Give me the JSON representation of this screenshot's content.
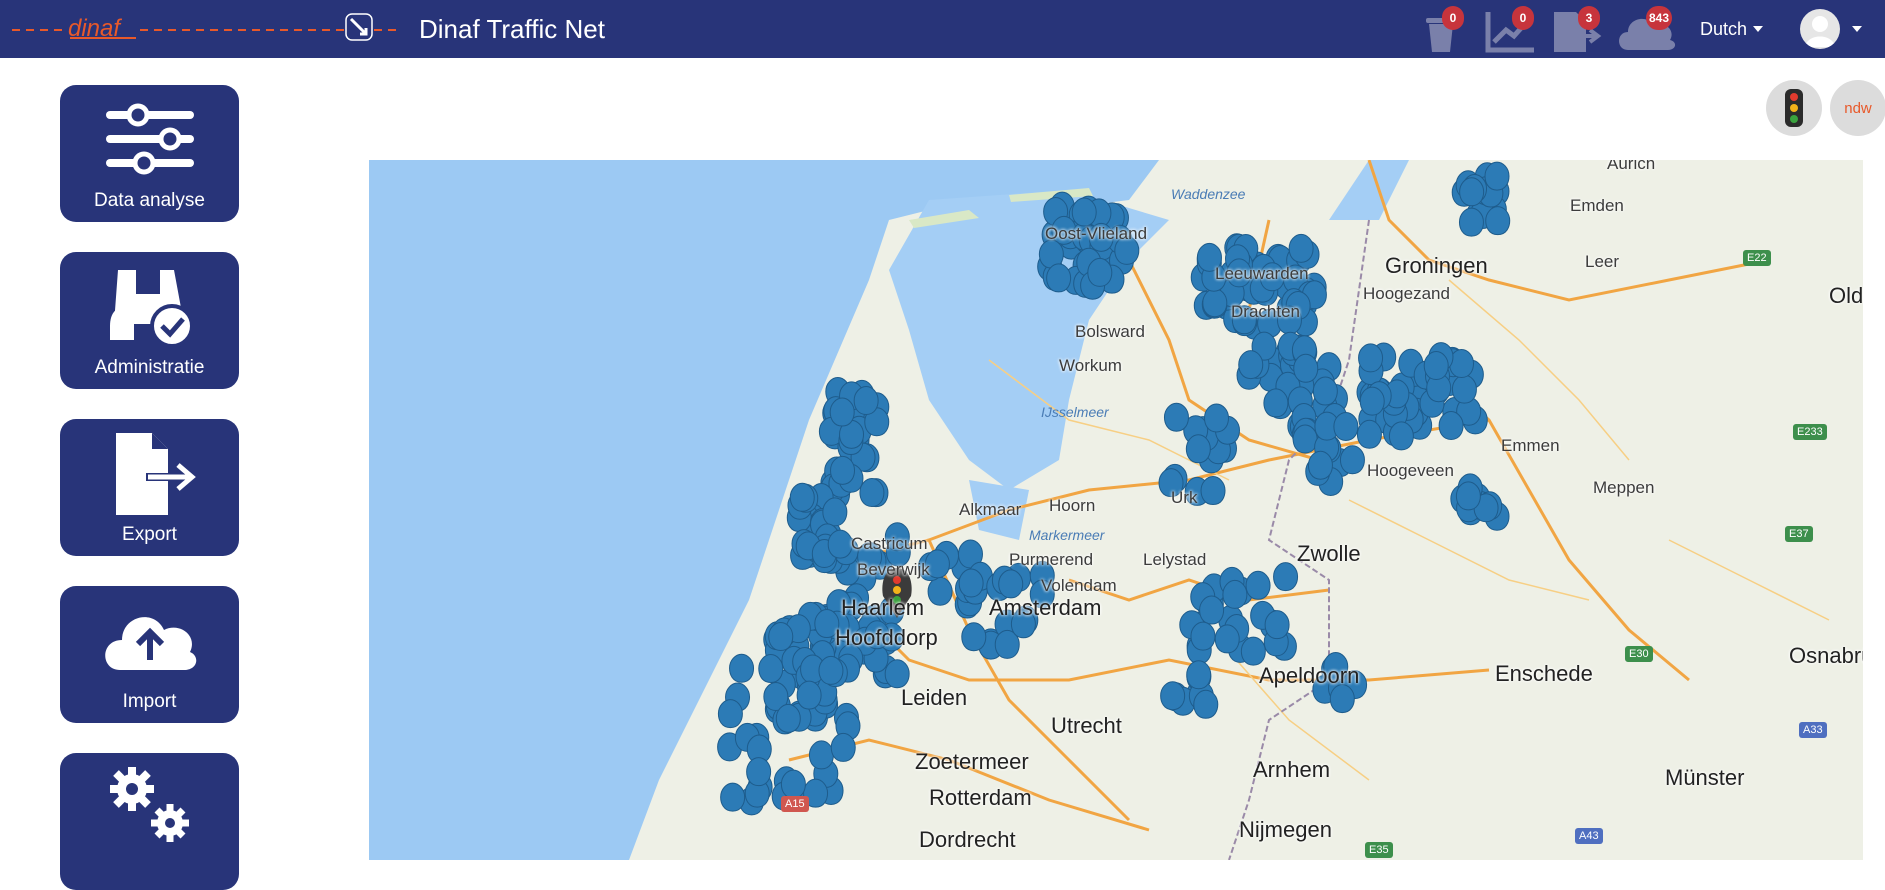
{
  "header": {
    "logo_text": "dinaf",
    "title": "Dinaf Traffic Net",
    "icons": [
      {
        "name": "trash-icon",
        "badge": "0"
      },
      {
        "name": "chart-icon",
        "badge": "0"
      },
      {
        "name": "export-file-icon",
        "badge": "3"
      },
      {
        "name": "cloud-upload-icon",
        "badge": "843"
      }
    ],
    "language": "Dutch"
  },
  "sidebar": {
    "items": [
      {
        "label": "Data analyse",
        "icon": "sliders-icon"
      },
      {
        "label": "Administratie",
        "icon": "binoculars-check-icon"
      },
      {
        "label": "Export",
        "icon": "file-export-icon"
      },
      {
        "label": "Import",
        "icon": "cloud-upload-icon"
      },
      {
        "label": "",
        "icon": "gears-icon"
      }
    ]
  },
  "toolbar": {
    "traffic_light_icon": "traffic-light-icon",
    "ndw_label": "ndw"
  },
  "map": {
    "places": [
      {
        "name": "Waddenzee"
      },
      {
        "name": "Oost-Vlieland"
      },
      {
        "name": "Leeuwarden"
      },
      {
        "name": "Groningen"
      },
      {
        "name": "Emden"
      },
      {
        "name": "Aurich"
      },
      {
        "name": "Leer"
      },
      {
        "name": "Olde"
      },
      {
        "name": "Bolsward"
      },
      {
        "name": "Workum"
      },
      {
        "name": "Drachten"
      },
      {
        "name": "Hoogezand"
      },
      {
        "name": "IJsselmeer"
      },
      {
        "name": "Hoogeveen"
      },
      {
        "name": "Emmen"
      },
      {
        "name": "Meppen"
      },
      {
        "name": "Urk"
      },
      {
        "name": "Alkmaar"
      },
      {
        "name": "Hoorn"
      },
      {
        "name": "Markermeer"
      },
      {
        "name": "Castricum"
      },
      {
        "name": "Beverwijk"
      },
      {
        "name": "Purmerend"
      },
      {
        "name": "Volendam"
      },
      {
        "name": "Lelystad"
      },
      {
        "name": "Zwolle"
      },
      {
        "name": "Haarlem"
      },
      {
        "name": "Amsterdam"
      },
      {
        "name": "Hoofddorp"
      },
      {
        "name": "Leiden"
      },
      {
        "name": "Apeldoorn"
      },
      {
        "name": "Enschede"
      },
      {
        "name": "Osnabrück"
      },
      {
        "name": "Zoetermeer"
      },
      {
        "name": "Utrecht"
      },
      {
        "name": "Arnhem"
      },
      {
        "name": "Münster"
      },
      {
        "name": "Nijmegen"
      },
      {
        "name": "Dordrecht"
      },
      {
        "name": "Rotterdam"
      }
    ],
    "road_shields": [
      "E22",
      "E233",
      "E37",
      "E30",
      "A33",
      "A15",
      "A43",
      "E35"
    ]
  }
}
